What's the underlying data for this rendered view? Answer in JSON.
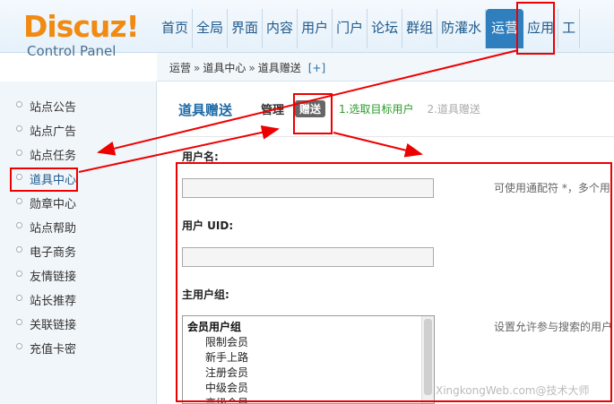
{
  "logo": {
    "word": "Discuz",
    "bang": "!",
    "subtitle": "Control Panel"
  },
  "nav": {
    "items": [
      "首页",
      "全局",
      "界面",
      "内容",
      "用户",
      "门户",
      "论坛",
      "群组",
      "防灌水",
      "运营",
      "应用",
      "工"
    ],
    "active": "运营"
  },
  "breadcrumb": {
    "items": [
      "运营",
      "道具中心",
      "道具赠送"
    ],
    "separator": "»",
    "plus": "[+]"
  },
  "sidebar": {
    "items": [
      "站点公告",
      "站点广告",
      "站点任务",
      "道具中心",
      "勋章中心",
      "站点帮助",
      "电子商务",
      "友情链接",
      "站长推荐",
      "关联链接",
      "充值卡密"
    ],
    "active": "道具中心"
  },
  "main": {
    "title": "道具赠送",
    "tab_manage": "管理",
    "tab_give": "赠送",
    "step1": "1.选取目标用户",
    "step2": "2.道具赠送",
    "username_label": "用户名:",
    "username_hint": "可使用通配符 *，多个用",
    "uid_label": "用户 UID:",
    "group_label": "主用户组:",
    "group_hint": "设置允许参与搜索的用户",
    "group_list": {
      "group": "会员用户组",
      "options": [
        "限制会员",
        "新手上路",
        "注册会员",
        "中级会员",
        "高级会员"
      ]
    }
  },
  "watermark": "XingkongWeb.com@技术大师",
  "colors": {
    "accent": "#2f7fbf",
    "annotation": "#e00000",
    "logo": "#f08a12"
  }
}
